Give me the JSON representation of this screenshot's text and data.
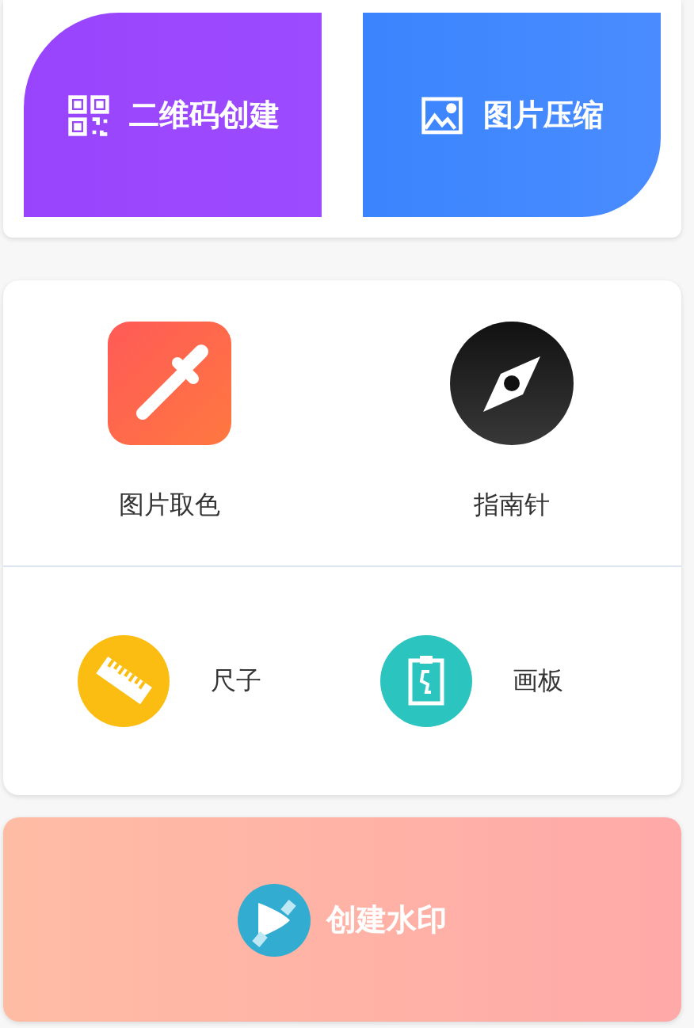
{
  "top_actions": [
    {
      "kind": "qr",
      "label": "二维码创建"
    },
    {
      "kind": "image",
      "label": "图片压缩"
    }
  ],
  "tools": [
    {
      "kind": "dropper",
      "label": "图片取色"
    },
    {
      "kind": "compass",
      "label": "指南针"
    }
  ],
  "small_tools": [
    {
      "kind": "ruler",
      "label": "尺子"
    },
    {
      "kind": "board",
      "label": "画板"
    }
  ],
  "watermark_button": {
    "label": "创建水印"
  }
}
